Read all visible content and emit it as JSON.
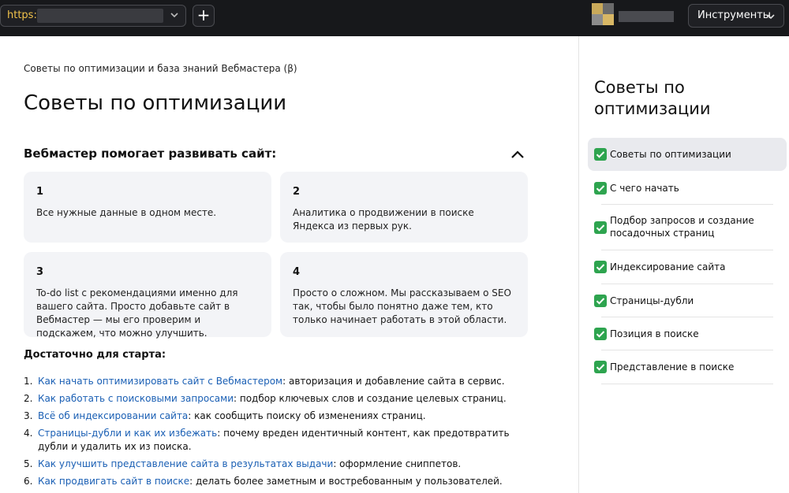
{
  "browser": {
    "url_prefix": "https:/",
    "tools_label": "Инструменты",
    "plus_label": "+"
  },
  "main": {
    "breadcrumb": "Советы по оптимизации и база знаний Вебмастера (β)",
    "title": "Советы по оптимизации",
    "section_title": "Вебмастер помогает развивать сайт:",
    "cards": [
      {
        "num": "1",
        "text": "Все нужные данные в одном месте."
      },
      {
        "num": "2",
        "text": "Аналитика о продвижении в поиске Яндекса из первых рук."
      },
      {
        "num": "3",
        "text": "To-do list с рекомендациями именно для вашего сайта. Просто добавьте сайт в Вебмастер — мы его проверим и подскажем, что можно улучшить."
      },
      {
        "num": "4",
        "text": "Просто о сложном. Мы рассказываем о SEO так, чтобы было понятно даже тем, кто только начинает работать в этой области."
      }
    ],
    "start_title": "Достаточно для старта:",
    "start_items": [
      {
        "num": "1.",
        "link": "Как начать оптимизировать сайт с Вебмастером",
        "rest": ": авторизация и добавление сайта в сервис."
      },
      {
        "num": "2.",
        "link": "Как работать с поисковыми запросами",
        "rest": ": подбор ключевых слов и создание целевых страниц."
      },
      {
        "num": "3.",
        "link": "Всё об индексировании сайта",
        "rest": ": как сообщить поиску об изменениях страниц."
      },
      {
        "num": "4.",
        "link": "Страницы-дубли и как их избежать",
        "rest": ": почему вреден идентичный контент, как предотвратить дубли и удалить их из поиска."
      },
      {
        "num": "5.",
        "link": "Как улучшить представление сайта в результатах выдачи",
        "rest": ": оформление сниппетов."
      },
      {
        "num": "6.",
        "link": "Как продвигать сайт в поиске",
        "rest": ": делать более заметным и востребованным у пользователей."
      }
    ]
  },
  "sidebar": {
    "title": "Советы по оптимизации",
    "items": [
      {
        "label": "Советы по оптимизации",
        "active": true
      },
      {
        "label": "С чего начать"
      },
      {
        "label": "Подбор запросов и создание посадочных страниц"
      },
      {
        "label": "Индексирование сайта"
      },
      {
        "label": "Страницы-дубли"
      },
      {
        "label": "Позиция в поиске"
      },
      {
        "label": "Представление в поиске"
      }
    ]
  },
  "colors": {
    "topbar": "#17181b",
    "url_text": "#f0c24b",
    "link": "#1a5fb4",
    "check": "#2ea44f",
    "card_bg": "#f3f4f7",
    "active_item_bg": "#e9eaee"
  }
}
